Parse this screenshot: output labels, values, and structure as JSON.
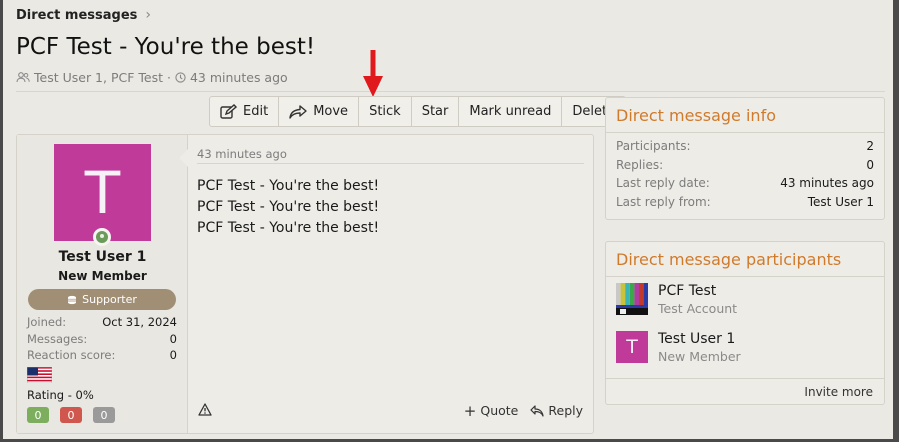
{
  "breadcrumb": {
    "label": "Direct messages"
  },
  "page": {
    "title": "PCF Test - You're the best!"
  },
  "meta": {
    "participants": "Test User 1, PCF Test",
    "separator": "·",
    "time": "43 minutes ago"
  },
  "toolbar": {
    "edit": "Edit",
    "move": "Move",
    "stick": "Stick",
    "star": "Star",
    "mark_unread": "Mark unread",
    "delete": "Delete"
  },
  "post": {
    "user": {
      "avatar_letter": "T",
      "avatar_color": "#c03b99",
      "name": "Test User 1",
      "title": "New Member",
      "banner": "Supporter",
      "stats": [
        {
          "label": "Joined:",
          "value": "Oct 31, 2024"
        },
        {
          "label": "Messages:",
          "value": "0"
        },
        {
          "label": "Reaction score:",
          "value": "0"
        }
      ],
      "flag": "us-flag-icon",
      "rating": "Rating - 0%",
      "rating_badges": [
        {
          "value": "0",
          "color": "#7cae5e"
        },
        {
          "value": "0",
          "color": "#d0574d"
        },
        {
          "value": "0",
          "color": "#9a9a9a"
        }
      ]
    },
    "time": "43 minutes ago",
    "lines": [
      "PCF Test - You're the best!",
      "PCF Test - You're the best!",
      "PCF Test - You're the best!"
    ],
    "quote": "Quote",
    "reply": "Reply"
  },
  "info": {
    "title": "Direct message info",
    "rows": [
      {
        "label": "Participants:",
        "value": "2"
      },
      {
        "label": "Replies:",
        "value": "0"
      },
      {
        "label": "Last reply date:",
        "value": "43 minutes ago"
      },
      {
        "label": "Last reply from:",
        "value": "Test User 1"
      }
    ]
  },
  "participants": {
    "title": "Direct message participants",
    "list": [
      {
        "name": "PCF Test",
        "title": "Test Account"
      },
      {
        "name": "Test User 1",
        "title": "New Member",
        "letter": "T"
      }
    ],
    "invite": "Invite more"
  },
  "colors": {
    "accent": "#d07a2c",
    "arrow": "#e0191c"
  }
}
